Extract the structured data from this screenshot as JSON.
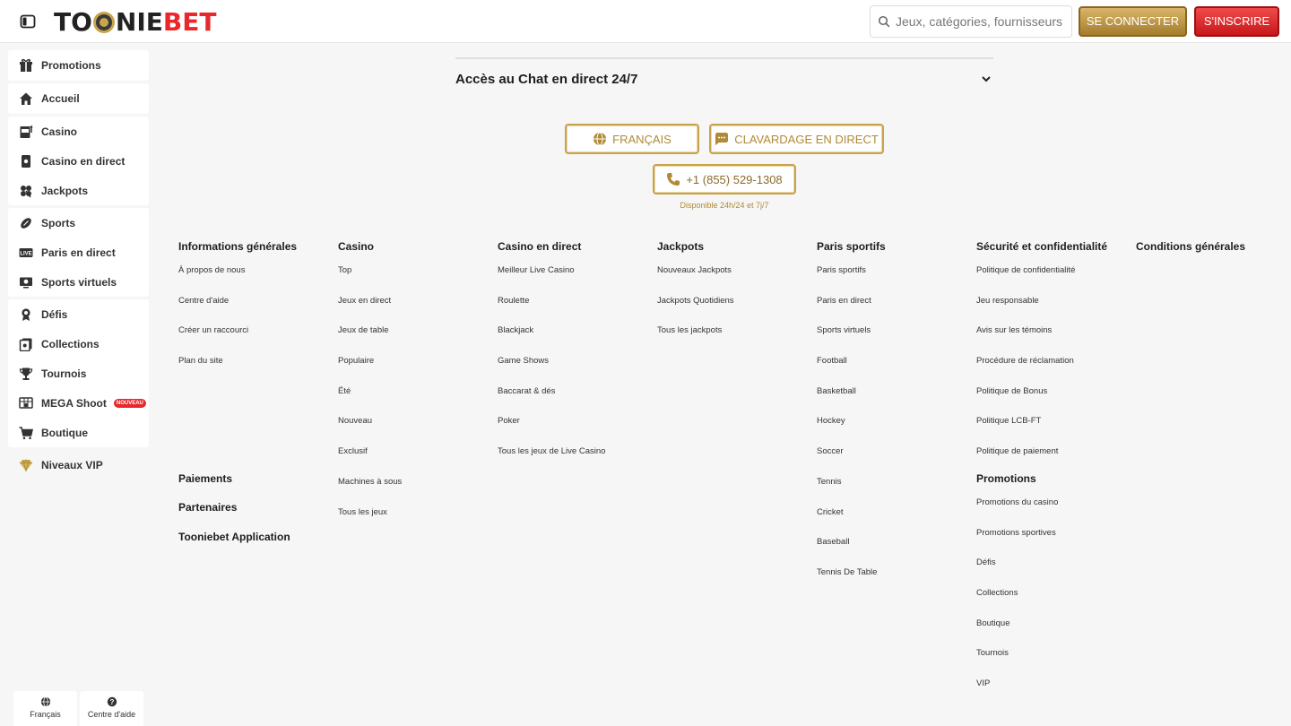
{
  "header": {
    "logo_text_1": "TO",
    "logo_text_2": "NIE",
    "logo_text_3": "BET",
    "search_placeholder": "Jeux, catégories, fournisseurs",
    "login_label": "SE CONNECTER",
    "signup_label": "S'INSCRIRE"
  },
  "sidebar": {
    "items": [
      {
        "label": "Promotions",
        "icon": "gift-icon"
      },
      {
        "label": "Accueil",
        "icon": "home-icon"
      },
      {
        "label": "Casino",
        "icon": "slot-machine-icon"
      },
      {
        "label": "Casino en direct",
        "icon": "cards-icon"
      },
      {
        "label": "Jackpots",
        "icon": "clover-icon"
      },
      {
        "label": "Sports",
        "icon": "football-icon"
      },
      {
        "label": "Paris en direct",
        "icon": "live-icon"
      },
      {
        "label": "Sports virtuels",
        "icon": "virtual-sports-icon"
      },
      {
        "label": "Défis",
        "icon": "medal-icon"
      },
      {
        "label": "Collections",
        "icon": "collections-icon"
      },
      {
        "label": "Tournois",
        "icon": "trophy-icon"
      },
      {
        "label": "MEGA Shoot",
        "icon": "mega-shoot-icon",
        "badge": "NOUVEAU"
      },
      {
        "label": "Boutique",
        "icon": "cart-icon"
      },
      {
        "label": "Niveaux VIP",
        "icon": "diamond-icon"
      }
    ]
  },
  "bottom_tabs": [
    {
      "label": "Français",
      "icon": "globe-icon"
    },
    {
      "label": "Centre d'aide",
      "icon": "help-icon"
    }
  ],
  "chat_panel": {
    "title": "Accès au Chat en direct 24/7"
  },
  "contact": {
    "language_label": "FRANÇAIS",
    "chat_label": "CLAVARDAGE EN DIRECT",
    "phone_label": "+1 (855) 529-1308",
    "availability": "Disponible 24h/24 et 7j/7"
  },
  "footer": {
    "columns": [
      {
        "title": "Informations générales",
        "links": [
          "À propos de nous",
          "Centre d'aide",
          "Créer un raccourci",
          "Plan du site"
        ]
      },
      {
        "title": "Casino",
        "links": [
          "Top",
          "Jeux en direct",
          "Jeux de table",
          "Populaire",
          "Été",
          "Nouveau",
          "Exclusif",
          "Machines à sous",
          "Tous les jeux"
        ]
      },
      {
        "title": "Casino en direct",
        "links": [
          "Meilleur Live Casino",
          "Roulette",
          "Blackjack",
          "Game Shows",
          "Baccarat & dés",
          "Poker",
          "Tous les jeux de Live Casino"
        ]
      },
      {
        "title": "Jackpots",
        "links": [
          "Nouveaux Jackpots",
          "Jackpots Quotidiens",
          "Tous les jackpots"
        ]
      },
      {
        "title": "Paris sportifs",
        "links": [
          "Paris sportifs",
          "Paris en direct",
          "Sports virtuels",
          "Football",
          "Basketball",
          "Hockey",
          "Soccer",
          "Tennis",
          "Cricket",
          "Baseball",
          "Tennis De Table"
        ]
      },
      {
        "title": "Sécurité et confidentialité",
        "links": [
          "Politique de confidentialité",
          "Jeu responsable",
          "Avis sur les témoins",
          "Procédure de réclamation",
          "Politique de Bonus",
          "Politique LCB-FT",
          "Politique de paiement"
        ]
      },
      {
        "title": "Conditions générales",
        "links": []
      }
    ],
    "extra_headings": [
      "Paiements",
      "Partenaires",
      "Tooniebet Application"
    ],
    "promotions": {
      "title": "Promotions",
      "links": [
        "Promotions du casino",
        "Promotions sportives",
        "Défis",
        "Collections",
        "Boutique",
        "Tournois",
        "VIP"
      ]
    }
  }
}
